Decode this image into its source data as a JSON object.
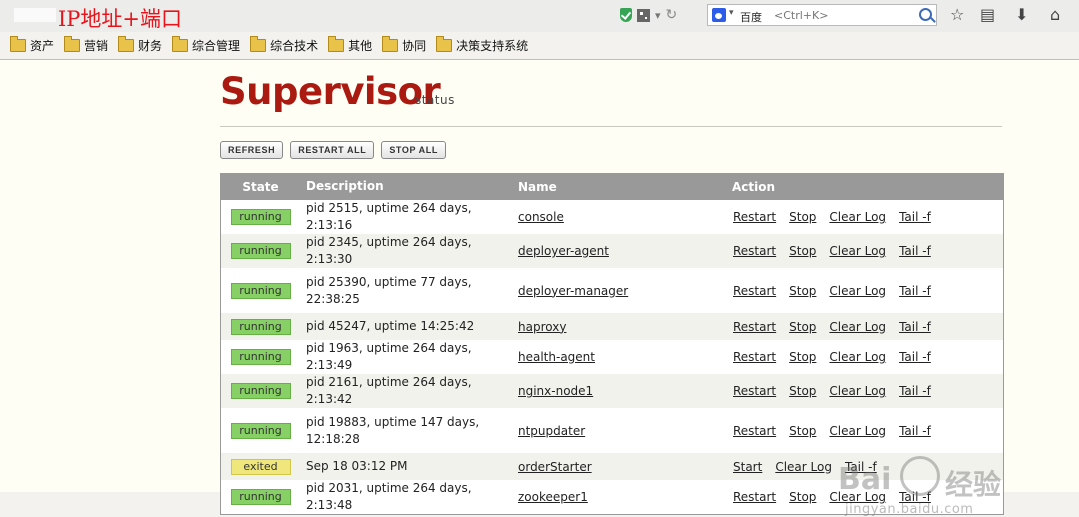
{
  "annotation": "IP地址+端口",
  "browser": {
    "search_engine": "百度",
    "search_placeholder": "<Ctrl+K>"
  },
  "bookmarks": [
    "资产",
    "营销",
    "财务",
    "综合管理",
    "综合技术",
    "其他",
    "协同",
    "决策支持系统"
  ],
  "header": {
    "title": "Supervisor",
    "subtitle": "status"
  },
  "buttons": {
    "refresh": "REFRESH",
    "restart_all": "RESTART ALL",
    "stop_all": "STOP ALL"
  },
  "table": {
    "headers": {
      "state": "State",
      "description": "Description",
      "name": "Name",
      "action": "Action"
    },
    "rows": [
      {
        "state": "running",
        "description": "pid 2515, uptime 264 days, 2:13:16",
        "name": "console",
        "actions": [
          "Restart",
          "Stop",
          "Clear Log",
          "Tail -f"
        ]
      },
      {
        "state": "running",
        "description": "pid 2345, uptime 264 days, 2:13:30",
        "name": "deployer-agent",
        "actions": [
          "Restart",
          "Stop",
          "Clear Log",
          "Tail -f"
        ]
      },
      {
        "state": "running",
        "description": "pid 25390, uptime 77 days, 22:38:25",
        "name": "deployer-manager",
        "actions": [
          "Restart",
          "Stop",
          "Clear Log",
          "Tail -f"
        ]
      },
      {
        "state": "running",
        "description": "pid 45247, uptime 14:25:42",
        "name": "haproxy",
        "actions": [
          "Restart",
          "Stop",
          "Clear Log",
          "Tail -f"
        ]
      },
      {
        "state": "running",
        "description": "pid 1963, uptime 264 days, 2:13:49",
        "name": "health-agent",
        "actions": [
          "Restart",
          "Stop",
          "Clear Log",
          "Tail -f"
        ]
      },
      {
        "state": "running",
        "description": "pid 2161, uptime 264 days, 2:13:42",
        "name": "nginx-node1",
        "actions": [
          "Restart",
          "Stop",
          "Clear Log",
          "Tail -f"
        ]
      },
      {
        "state": "running",
        "description": "pid 19883, uptime 147 days, 12:18:28",
        "name": "ntpupdater",
        "actions": [
          "Restart",
          "Stop",
          "Clear Log",
          "Tail -f"
        ]
      },
      {
        "state": "exited",
        "description": "Sep 18 03:12 PM",
        "name": "orderStarter",
        "actions": [
          "Start",
          "Clear Log",
          "Tail -f"
        ]
      },
      {
        "state": "running",
        "description": "pid 2031, uptime 264 days, 2:13:48",
        "name": "zookeeper1",
        "actions": [
          "Restart",
          "Stop",
          "Clear Log",
          "Tail -f"
        ]
      }
    ]
  },
  "watermark": {
    "brand": "Bai",
    "brand_cn": "经验",
    "url": "jingyan.baidu.com"
  },
  "colors": {
    "running": "#87d065",
    "exited": "#efe77b",
    "logo": "#aa1a10",
    "header_bg": "#999999"
  }
}
